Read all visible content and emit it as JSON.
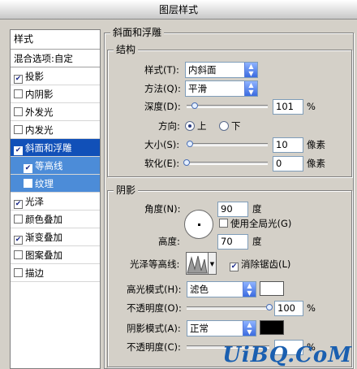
{
  "window": {
    "title": "图层样式"
  },
  "sidebar": {
    "header": "样式",
    "blend_options": "混合选项:自定",
    "items": [
      {
        "label": "投影",
        "checked": true
      },
      {
        "label": "内阴影",
        "checked": false
      },
      {
        "label": "外发光",
        "checked": false
      },
      {
        "label": "内发光",
        "checked": false
      },
      {
        "label": "斜面和浮雕",
        "checked": true,
        "selected": true
      },
      {
        "label": "等高线",
        "checked": true,
        "sub": true
      },
      {
        "label": "纹理",
        "checked": false,
        "sub": true
      },
      {
        "label": "光泽",
        "checked": true
      },
      {
        "label": "颜色叠加",
        "checked": false
      },
      {
        "label": "渐变叠加",
        "checked": true
      },
      {
        "label": "图案叠加",
        "checked": false
      },
      {
        "label": "描边",
        "checked": false
      }
    ]
  },
  "bevel": {
    "legend": "斜面和浮雕",
    "structure": {
      "legend": "结构",
      "style_label": "样式(T):",
      "style_value": "内斜面",
      "technique_label": "方法(Q):",
      "technique_value": "平滑",
      "depth_label": "深度(D):",
      "depth_value": "101",
      "depth_unit": "%",
      "depth_fraction": 0.1,
      "direction_label": "方向:",
      "direction_up": "上",
      "direction_down": "下",
      "size_label": "大小(S):",
      "size_value": "10",
      "size_unit": "像素",
      "size_fraction": 0.04,
      "soften_label": "软化(E):",
      "soften_value": "0",
      "soften_unit": "像素",
      "soften_fraction": 0
    },
    "shading": {
      "legend": "阴影",
      "angle_label": "角度(N):",
      "angle_value": "90",
      "angle_unit": "度",
      "global_light_label": "使用全局光(G)",
      "altitude_label": "高度:",
      "altitude_value": "70",
      "altitude_unit": "度",
      "gloss_contour_label": "光泽等高线:",
      "anti_alias_label": "消除锯齿(L)",
      "highlight_mode_label": "高光模式(H):",
      "highlight_mode_value": "滤色",
      "highlight_color": "#ffffff",
      "highlight_opacity_label": "不透明度(O):",
      "highlight_opacity_value": "100",
      "highlight_opacity_unit": "%",
      "highlight_opacity_fraction": 1,
      "shadow_mode_label": "阴影模式(A):",
      "shadow_mode_value": "正常",
      "shadow_color": "#000000",
      "shadow_opacity_label": "不透明度(C):",
      "shadow_opacity_unit": "%"
    }
  },
  "watermark": "UiBQ.CoM"
}
